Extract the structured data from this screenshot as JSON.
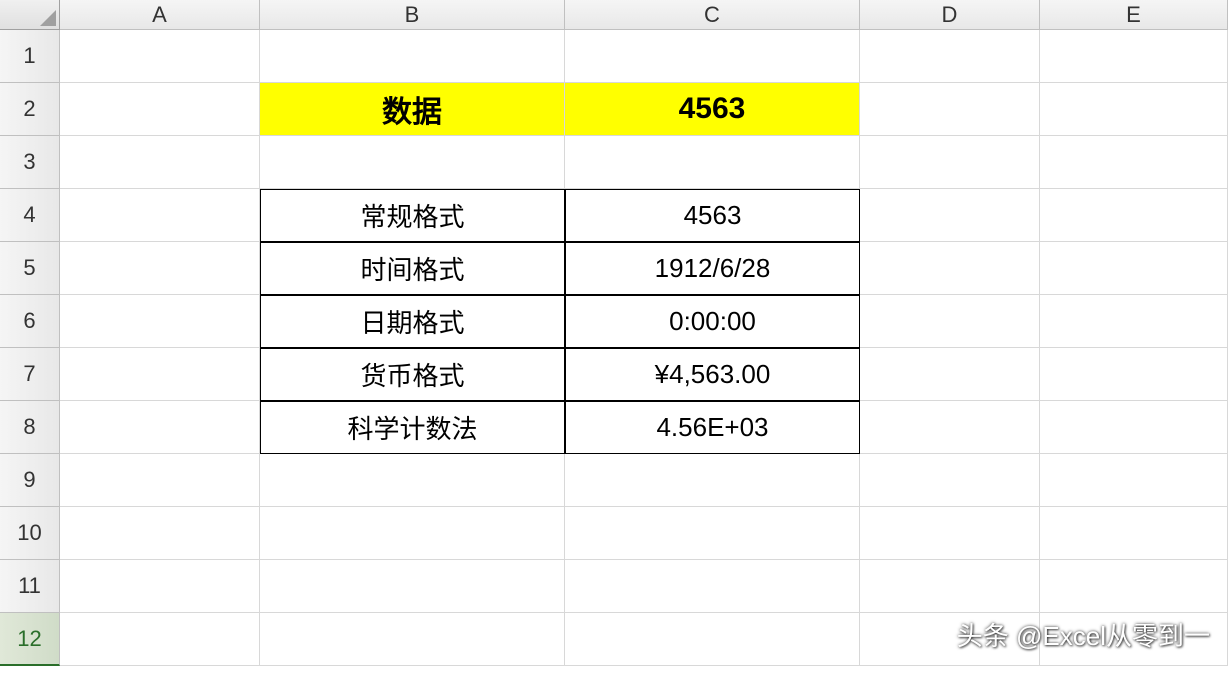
{
  "columns": [
    "A",
    "B",
    "C",
    "D",
    "E"
  ],
  "rows": [
    "1",
    "2",
    "3",
    "4",
    "5",
    "6",
    "7",
    "8",
    "9",
    "10",
    "11",
    "12"
  ],
  "selected_row_index": 11,
  "header": {
    "label": "数据",
    "value": "4563"
  },
  "formats": [
    {
      "label": "常规格式",
      "value": "4563"
    },
    {
      "label": "时间格式",
      "value": "1912/6/28"
    },
    {
      "label": "日期格式",
      "value": "0:00:00"
    },
    {
      "label": "货币格式",
      "value": "¥4,563.00"
    },
    {
      "label": "科学计数法",
      "value": "4.56E+03"
    }
  ],
  "watermark": "头条 @Excel从零到一"
}
